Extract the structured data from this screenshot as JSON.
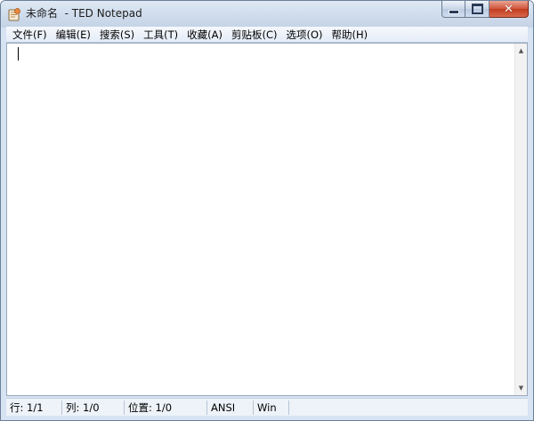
{
  "window": {
    "title": "未命名  - TED Notepad",
    "app_icon": "notepad-app-icon",
    "caption_buttons": {
      "minimize_icon": "minimize-icon",
      "maximize_icon": "maximize-icon",
      "close_label": "✕"
    }
  },
  "menubar": {
    "items": [
      {
        "label": "文件(F)"
      },
      {
        "label": "编辑(E)"
      },
      {
        "label": "搜索(S)"
      },
      {
        "label": "工具(T)"
      },
      {
        "label": "收藏(A)"
      },
      {
        "label": "剪贴板(C)"
      },
      {
        "label": "选项(O)"
      },
      {
        "label": "帮助(H)"
      }
    ]
  },
  "editor": {
    "content": "",
    "scrollbar": {
      "up_arrow": "▲",
      "down_arrow": "▼"
    }
  },
  "statusbar": {
    "line": "行: 1/1",
    "column": "列: 1/0",
    "position": "位置: 1/0",
    "encoding": "ANSI",
    "line_endings": "Win"
  },
  "colors": {
    "titlebar": "#cfdcec",
    "close_button": "#c23b1f",
    "editor_background": "#ffffff"
  }
}
